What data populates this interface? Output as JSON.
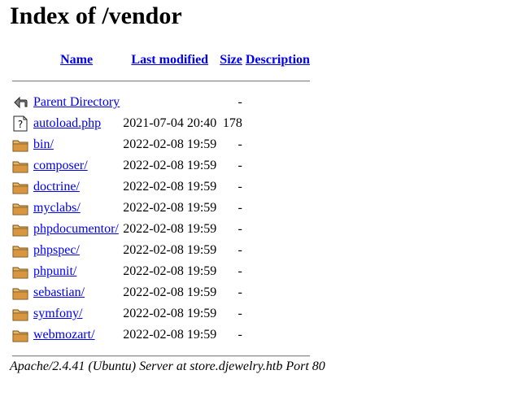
{
  "page_title": "Index of /vendor",
  "columns": {
    "name": "Name",
    "last_modified": "Last modified",
    "size": "Size",
    "description": "Description"
  },
  "parent": {
    "name": "Parent Directory",
    "size": "-",
    "icon": "back-icon"
  },
  "entries": [
    {
      "name": "autoload.php",
      "modified": "2021-07-04 20:40",
      "size": "178",
      "icon": "unknown-file-icon"
    },
    {
      "name": "bin/",
      "modified": "2022-02-08 19:59",
      "size": "-",
      "icon": "folder-icon"
    },
    {
      "name": "composer/",
      "modified": "2022-02-08 19:59",
      "size": "-",
      "icon": "folder-icon"
    },
    {
      "name": "doctrine/",
      "modified": "2022-02-08 19:59",
      "size": "-",
      "icon": "folder-icon"
    },
    {
      "name": "myclabs/",
      "modified": "2022-02-08 19:59",
      "size": "-",
      "icon": "folder-icon"
    },
    {
      "name": "phpdocumentor/",
      "modified": "2022-02-08 19:59",
      "size": "-",
      "icon": "folder-icon"
    },
    {
      "name": "phpspec/",
      "modified": "2022-02-08 19:59",
      "size": "-",
      "icon": "folder-icon"
    },
    {
      "name": "phpunit/",
      "modified": "2022-02-08 19:59",
      "size": "-",
      "icon": "folder-icon"
    },
    {
      "name": "sebastian/",
      "modified": "2022-02-08 19:59",
      "size": "-",
      "icon": "folder-icon"
    },
    {
      "name": "symfony/",
      "modified": "2022-02-08 19:59",
      "size": "-",
      "icon": "folder-icon"
    },
    {
      "name": "webmozart/",
      "modified": "2022-02-08 19:59",
      "size": "-",
      "icon": "folder-icon"
    }
  ],
  "footer": "Apache/2.4.41 (Ubuntu) Server at store.djewelry.htb Port 80",
  "colors": {
    "link": "#0000ee",
    "folder": "#d9a25b"
  }
}
